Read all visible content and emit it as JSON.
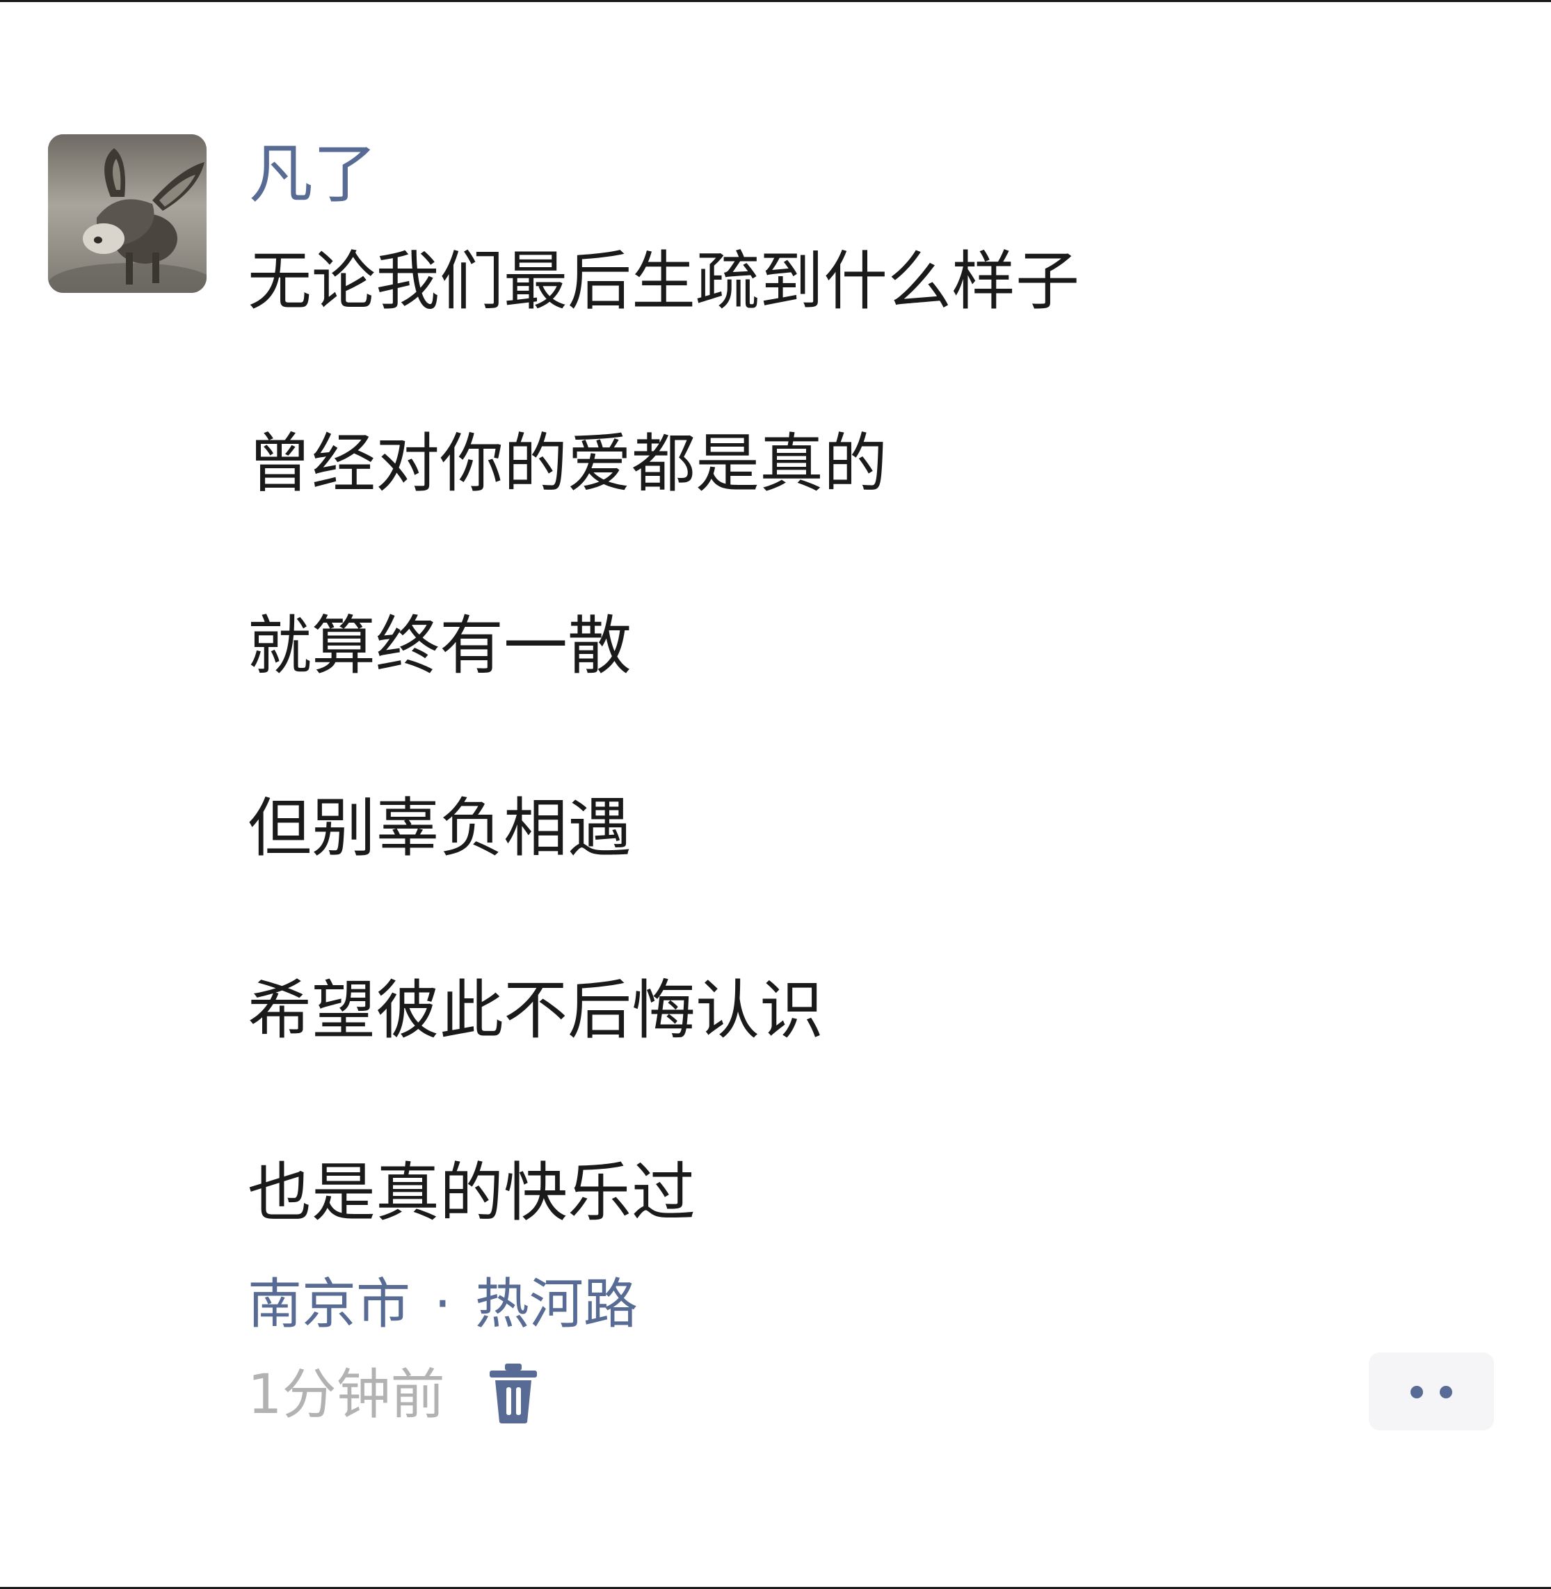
{
  "post": {
    "username": "凡了",
    "avatar_icon": "donkey-photo-avatar",
    "lines": [
      "无论我们最后生疏到什么样子",
      "曾经对你的爱都是真的",
      "就算终有一散",
      "但别辜负相遇",
      "希望彼此不后悔认识",
      "也是真的快乐过"
    ],
    "location": {
      "city": "南京市",
      "separator": "·",
      "street": "热河路"
    },
    "time": "1分钟前",
    "delete_icon": "trash-icon",
    "more_icon": "more-dots-icon",
    "colors": {
      "link": "#576b95",
      "text": "#1a1a1a",
      "meta": "#b2b2b2",
      "more_bg": "#f5f5f7"
    }
  }
}
